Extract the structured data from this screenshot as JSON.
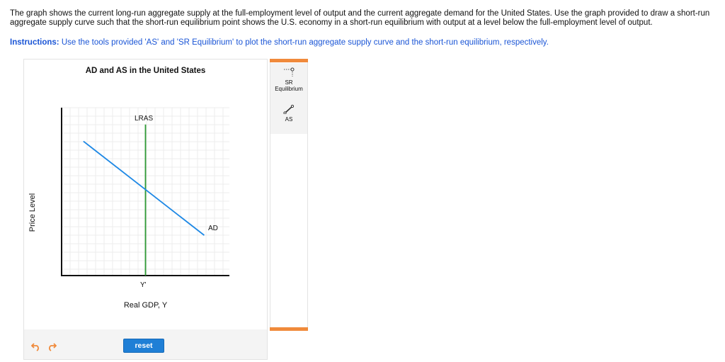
{
  "question": {
    "text": "The graph shows the current long-run aggregate supply at the full-employment level of output and the current aggregate demand for the United States. Use the graph provided to draw a short-run aggregate supply curve such that the short-run equilibrium point shows the U.S. economy in a short-run equilibrium with output at a level below the full-employment level of output."
  },
  "instructions": {
    "label": "Instructions:",
    "text": " Use the tools provided 'AS' and 'SR Equilibrium' to plot the short-run aggregate supply curve and the short-run equilibrium, respectively."
  },
  "graph": {
    "title": "AD and AS in the United States",
    "ylabel": "Price Level",
    "xlabel": "Real GDP, Y",
    "tick_label": "Y'",
    "lras_label": "LRAS",
    "ad_label": "AD",
    "reset_label": "reset"
  },
  "tools": {
    "sr_label_1": "SR",
    "sr_label_2": "Equilibrium",
    "as_label": "AS"
  },
  "colors": {
    "lras": "#2e9a35",
    "ad": "#1e88e5",
    "accent": "#f08a3b",
    "link": "#1a55d6",
    "button": "#1f7fd6"
  },
  "icons": [
    "undo-icon",
    "redo-icon",
    "sr-equilibrium-tool-icon",
    "line-tool-icon"
  ],
  "chart_data": {
    "type": "line",
    "title": "AD and AS in the United States",
    "xlabel": "Real GDP, Y",
    "ylabel": "Price Level",
    "x_ticks": [
      "Y'"
    ],
    "series": [
      {
        "name": "LRAS",
        "x": [
          0.5,
          0.5
        ],
        "y": [
          0,
          0.9
        ]
      },
      {
        "name": "AD",
        "x": [
          0.13,
          0.85
        ],
        "y": [
          0.8,
          0.24
        ]
      }
    ],
    "xlim": [
      0,
      1
    ],
    "ylim": [
      0,
      1
    ],
    "grid": true
  }
}
